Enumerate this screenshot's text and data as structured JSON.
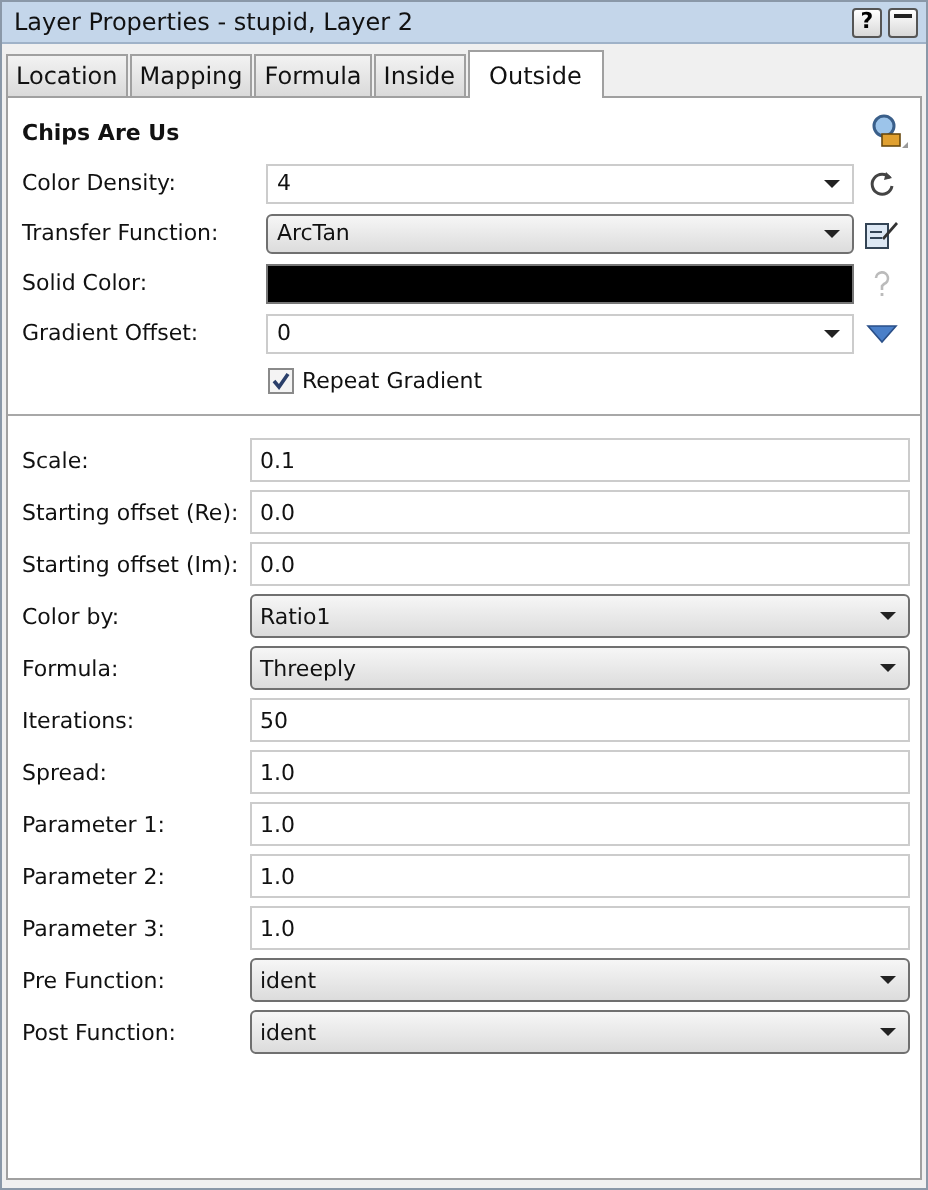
{
  "window": {
    "title": "Layer Properties - stupid, Layer 2",
    "help_button": "?"
  },
  "tabs": [
    {
      "label": "Location",
      "selected": false
    },
    {
      "label": "Mapping",
      "selected": false
    },
    {
      "label": "Formula",
      "selected": false
    },
    {
      "label": "Inside",
      "selected": false
    },
    {
      "label": "Outside",
      "selected": true
    }
  ],
  "section_title": "Chips Are Us",
  "coloring": [
    {
      "kind": "combo",
      "label": "Color Density:",
      "value": "4"
    },
    {
      "kind": "select",
      "label": "Transfer Function:",
      "value": "ArcTan"
    },
    {
      "kind": "color",
      "label": "Solid Color:",
      "color": "#000000"
    },
    {
      "kind": "combo",
      "label": "Gradient Offset:",
      "value": "0"
    }
  ],
  "repeat_gradient": {
    "label": "Repeat Gradient",
    "checked": true
  },
  "parameters": [
    {
      "kind": "text",
      "label": "Scale:",
      "value": "0.1"
    },
    {
      "kind": "text",
      "label": "Starting offset (Re):",
      "value": "0.0"
    },
    {
      "kind": "text",
      "label": "Starting offset (Im):",
      "value": "0.0"
    },
    {
      "kind": "select",
      "label": "Color by:",
      "value": "Ratio1"
    },
    {
      "kind": "select",
      "label": "Formula:",
      "value": "Threeply"
    },
    {
      "kind": "text",
      "label": "Iterations:",
      "value": "50"
    },
    {
      "kind": "text",
      "label": "Spread:",
      "value": "1.0"
    },
    {
      "kind": "text",
      "label": "Parameter 1:",
      "value": "1.0"
    },
    {
      "kind": "text",
      "label": "Parameter 2:",
      "value": "1.0"
    },
    {
      "kind": "text",
      "label": "Parameter 3:",
      "value": "1.0"
    },
    {
      "kind": "select",
      "label": "Pre Function:",
      "value": "ident"
    },
    {
      "kind": "select",
      "label": "Post Function:",
      "value": "ident"
    }
  ]
}
